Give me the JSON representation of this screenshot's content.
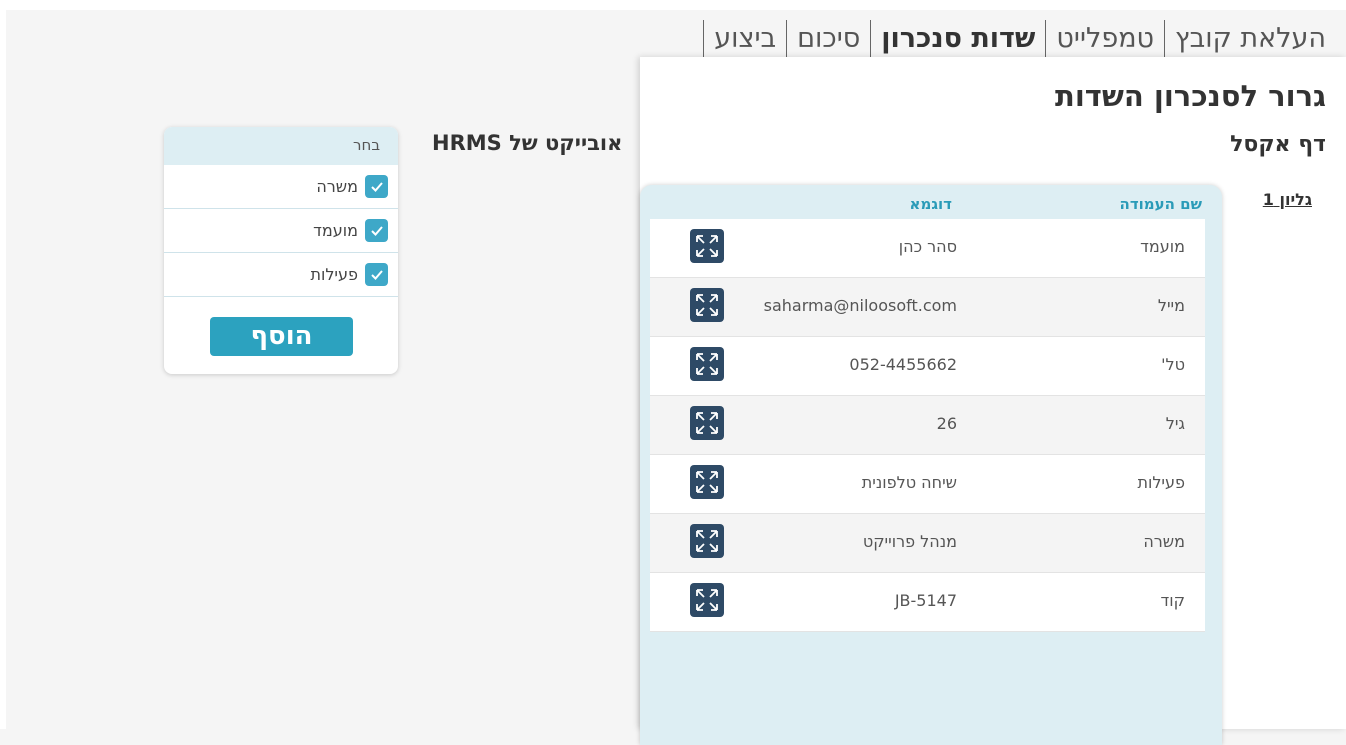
{
  "steps": [
    {
      "label": "העלאת קובץ",
      "active": false
    },
    {
      "label": "טמפלייט",
      "active": false
    },
    {
      "label": "שדות סנכרון",
      "active": true
    },
    {
      "label": "סיכום",
      "active": false
    },
    {
      "label": "ביצוע",
      "active": false
    }
  ],
  "panel": {
    "title": "גרור לסנכרון השדות",
    "subtitle": "דף אקסל",
    "sheet_link": "גליון 1"
  },
  "columns_table": {
    "header_name": "שם העמודה",
    "header_example": "דוגמא",
    "rows": [
      {
        "name": "מועמד",
        "example": "סהר כהן"
      },
      {
        "name": "מייל",
        "example": "saharma@niloosoft.com"
      },
      {
        "name": "טל'",
        "example": "052-4455662"
      },
      {
        "name": "גיל",
        "example": "26"
      },
      {
        "name": "פעילות",
        "example": "שיחה טלפונית"
      },
      {
        "name": "משרה",
        "example": "מנהל פרוייקט"
      },
      {
        "name": "קוד",
        "example": "JB-5147"
      }
    ],
    "drag_icon": "expand-arrows-icon"
  },
  "hrms": {
    "label": "אובייקט של HRMS",
    "select_header": "בחר",
    "items": [
      {
        "label": "משרה",
        "checked": true
      },
      {
        "label": "מועמד",
        "checked": true
      },
      {
        "label": "פעילות",
        "checked": true
      }
    ],
    "add_button": "הוסף"
  },
  "colors": {
    "accent": "#2ca2bf",
    "drag_button": "#2e4a66",
    "card_bg": "#ddeef3"
  }
}
